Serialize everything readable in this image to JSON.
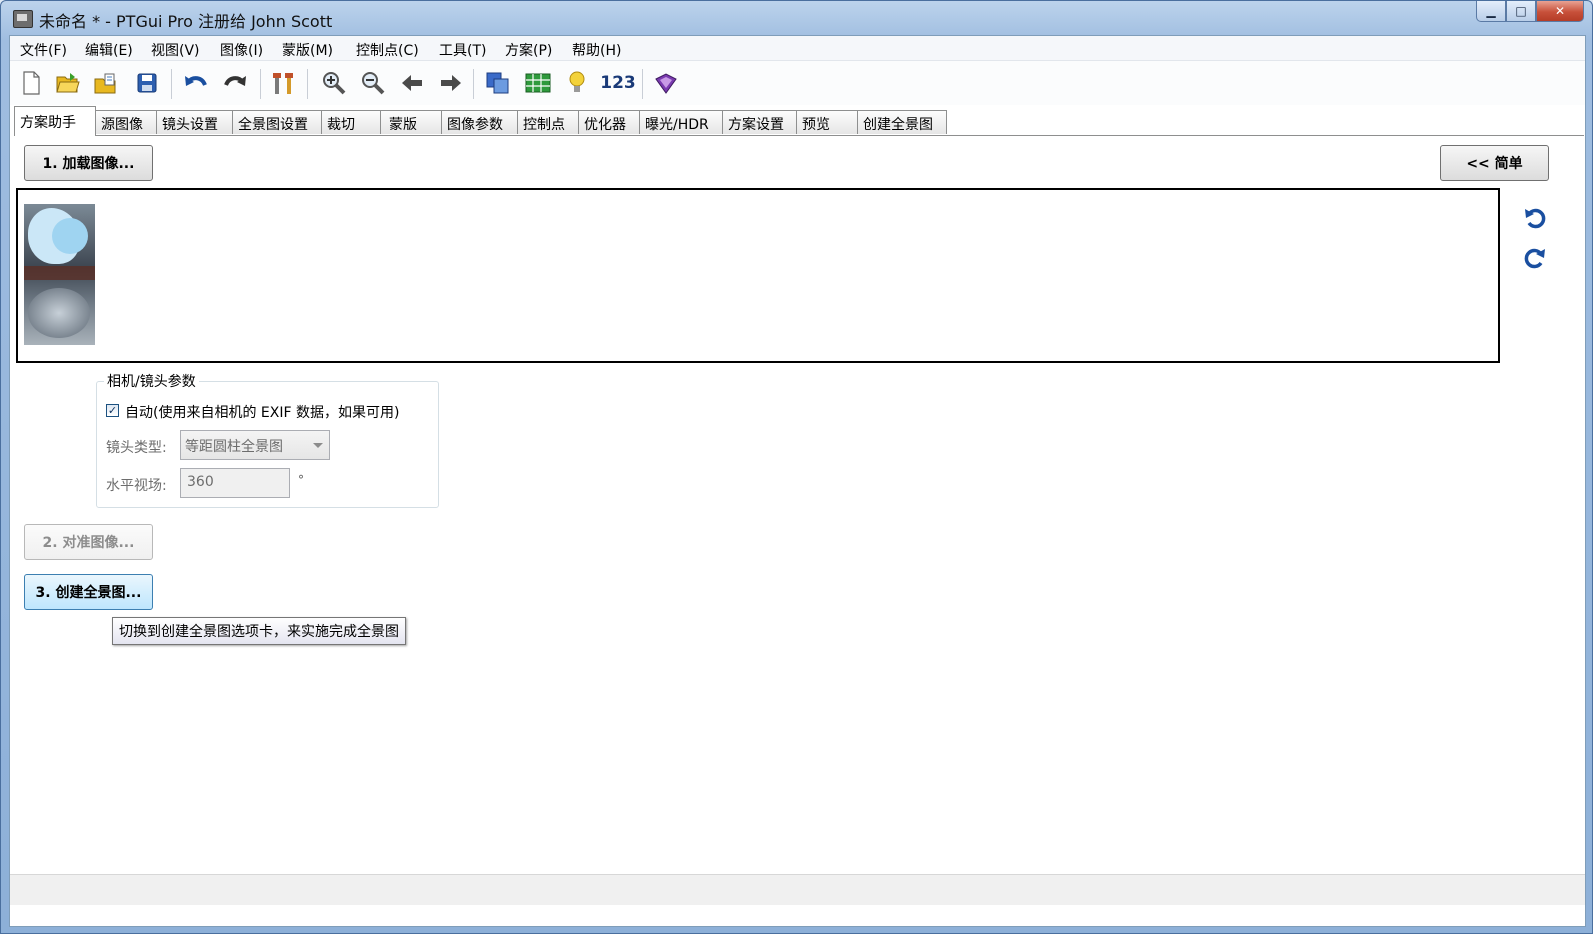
{
  "window": {
    "title": "未命名 * - PTGui Pro 注册给 John Scott",
    "minimize_glyph": "▁",
    "maximize_glyph": "□",
    "close_glyph": "✕"
  },
  "menu": [
    "文件(F)",
    "编辑(E)",
    "视图(V)",
    "图像(I)",
    "蒙版(M)",
    "控制点(C)",
    "工具(T)",
    "方案(P)",
    "帮助(H)"
  ],
  "toolbar": {
    "icons": [
      "new-file-icon",
      "open-folder-icon",
      "open-recent-icon",
      "save-icon",
      "undo-icon",
      "redo-icon",
      "tools-icon",
      "zoom-in-icon",
      "zoom-out-icon",
      "back-arrow-icon",
      "forward-arrow-icon",
      "panorama-editor-icon",
      "table-icon",
      "lightbulb-icon",
      "numbering-icon",
      "help-book-icon"
    ],
    "numbering_label": "123"
  },
  "tabs": [
    "方案助手",
    "源图像",
    "镜头设置",
    "全景图设置",
    "裁切",
    "蒙版",
    "图像参数",
    "控制点",
    "优化器",
    "曝光/HDR",
    "方案设置",
    "预览",
    "创建全景图"
  ],
  "assistant": {
    "load_images": "1. 加载图像...",
    "simple_toggle": "<< 简单",
    "camera_group_title": "相机/镜头参数",
    "auto_exif_checked": true,
    "auto_exif_check_glyph": "✓",
    "auto_exif_label": "自动(使用来自相机的 EXIF 数据，如果可用)",
    "lens_type_label": "镜头类型:",
    "lens_type_value": "等距圆柱全景图",
    "hfov_label": "水平视场:",
    "hfov_value": "360",
    "hfov_unit": "°",
    "align_images": "2. 对准图像...",
    "create_panorama": "3. 创建全景图...",
    "tooltip": "切换到创建全景图选项卡，来实施完成全景图"
  },
  "colors": {
    "accent_blue": "#1a4fa0",
    "tooltip_bg": "#f0f0f8",
    "hover_button": "#bee6fd"
  }
}
